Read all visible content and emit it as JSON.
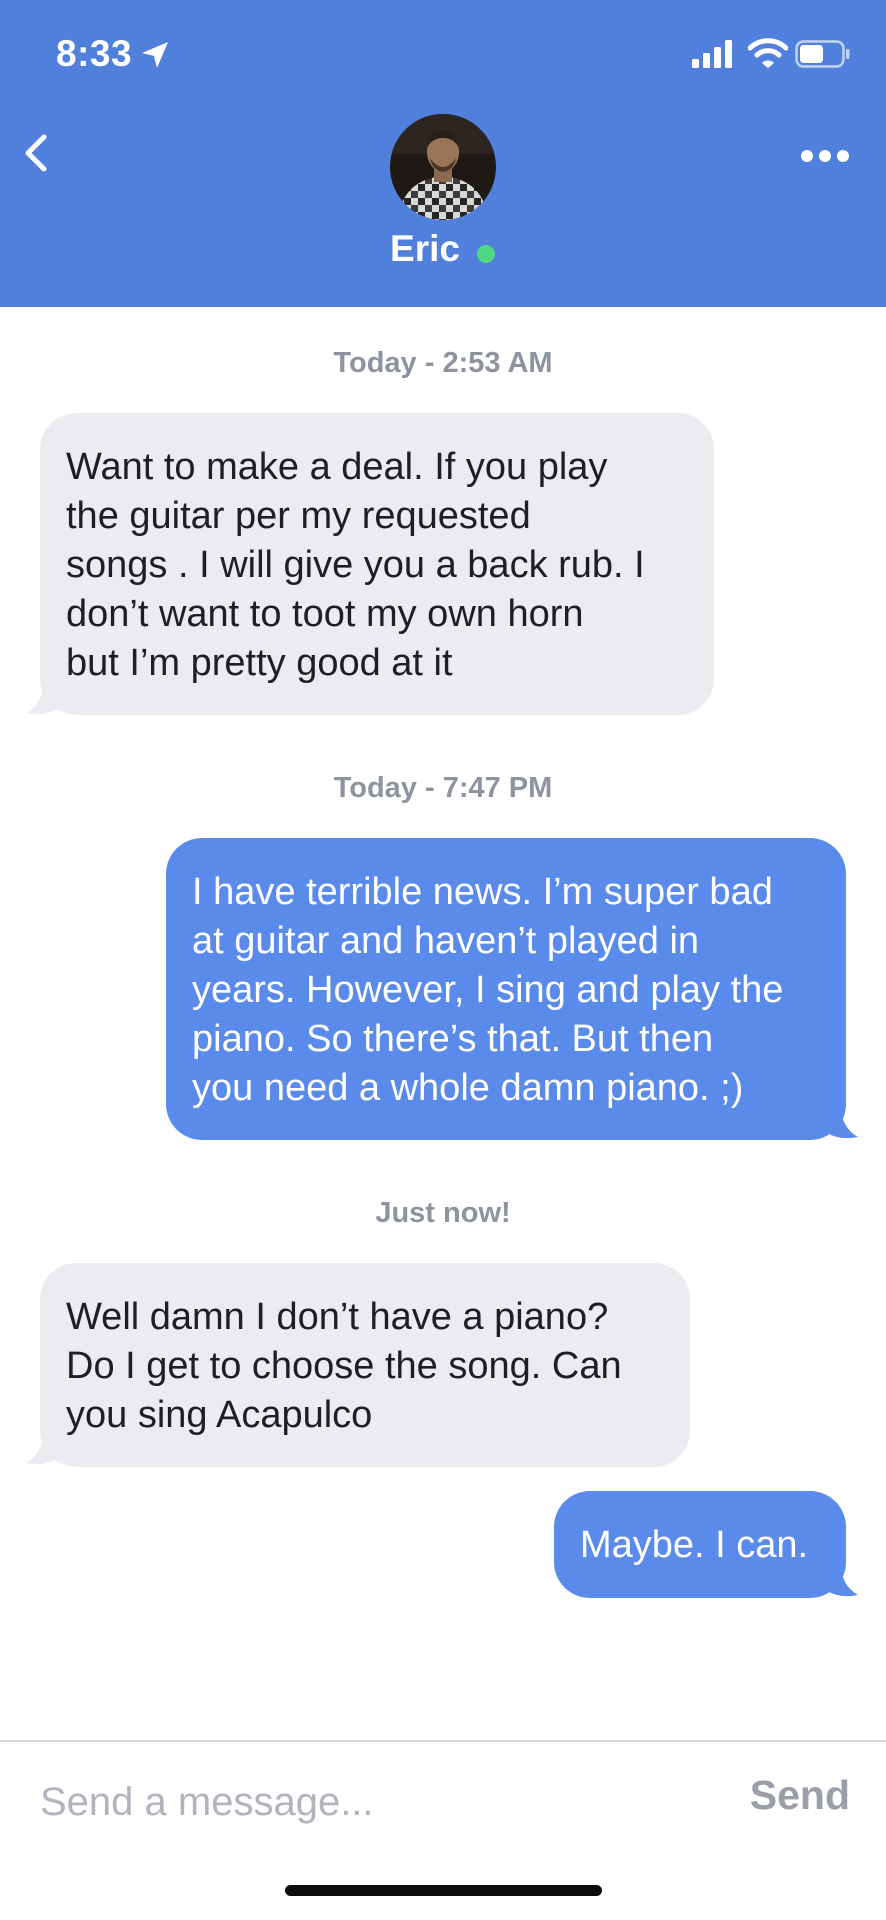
{
  "status_bar": {
    "time": "8:33"
  },
  "header": {
    "contact_name": "Eric",
    "online_color": "#4fd781",
    "background": "#5080db"
  },
  "conversation": {
    "timestamps": [
      "Today - 2:53 AM",
      "Today - 7:47 PM",
      "Just now!"
    ],
    "messages": [
      {
        "direction": "incoming",
        "lines": [
          "Want to make a deal. If you play",
          "the guitar per my requested",
          "songs . I will give you a back rub. I",
          "don’t want to toot my own horn",
          "but I’m pretty good at it"
        ]
      },
      {
        "direction": "outgoing",
        "lines": [
          "I have terrible news. I’m super bad",
          "at guitar and haven’t played in",
          "years. However, I sing and play the",
          "piano. So there’s that. But then",
          "you need a whole damn piano. ;)"
        ]
      },
      {
        "direction": "incoming",
        "lines": [
          "Well damn I don’t have a piano?",
          "Do I get to choose the song. Can",
          "you sing Acapulco"
        ]
      },
      {
        "direction": "outgoing",
        "lines": [
          "Maybe. I can."
        ]
      }
    ]
  },
  "composer": {
    "placeholder": "Send a message...",
    "send_label": "Send"
  },
  "icons": [
    "location-arrow-icon",
    "signal-icon",
    "wifi-icon",
    "battery-icon",
    "back-chevron-icon",
    "more-options-icon"
  ],
  "colors": {
    "incoming_bubble": "#ebecf0",
    "outgoing_bubble": "#5b8bea",
    "timestamp": "#8e93a0"
  }
}
